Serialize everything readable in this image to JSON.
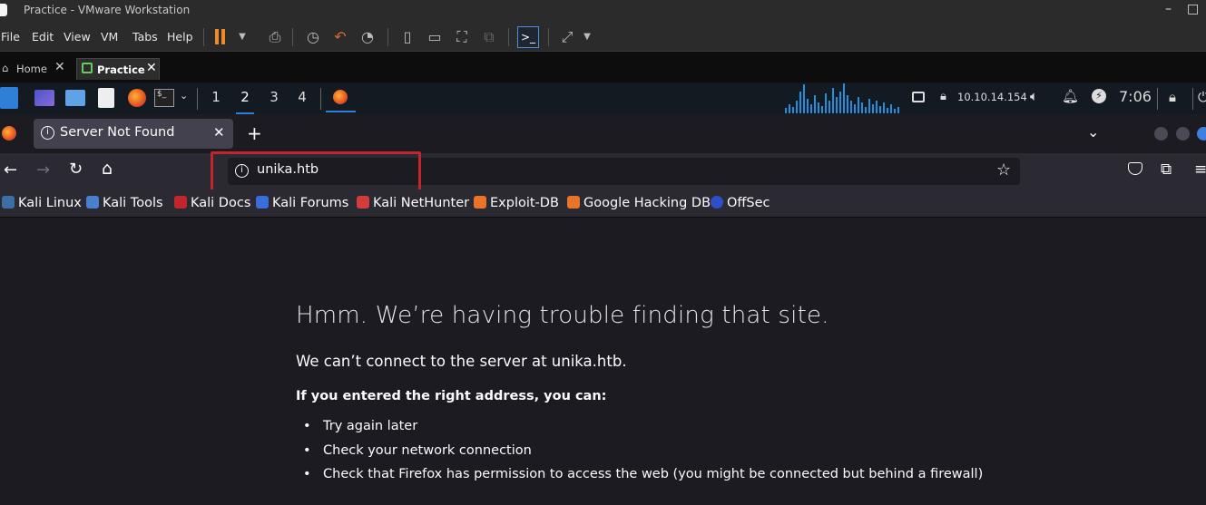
{
  "vmware": {
    "title": "Practice - VMware Workstation",
    "menu": [
      "File",
      "Edit",
      "View",
      "VM",
      "Tabs",
      "Help"
    ],
    "tabs": [
      {
        "label": "Home",
        "active": false
      },
      {
        "label": "Practice",
        "active": true
      }
    ]
  },
  "kali_panel": {
    "workspaces": [
      "1",
      "2",
      "3",
      "4"
    ],
    "active_workspace": "2",
    "ip": "10.10.14.154",
    "time": "7:06"
  },
  "firefox": {
    "tab_title": "Server Not Found",
    "url": "unika.htb",
    "bookmarks": [
      "Kali Linux",
      "Kali Tools",
      "Kali Docs",
      "Kali Forums",
      "Kali NetHunter",
      "Exploit-DB",
      "Google Hacking DB",
      "OffSec"
    ]
  },
  "error_page": {
    "title": "Hmm. We’re having trouble finding that site.",
    "description": "We can’t connect to the server at unika.htb.",
    "hint": "If you entered the right address, you can:",
    "suggestions": [
      "Try again later",
      "Check your network connection",
      "Check that Firefox has permission to access the web (you might be connected but behind a firewall)"
    ]
  },
  "colors": {
    "highlight": "#c0262c",
    "accent": "#2f7fd8"
  }
}
